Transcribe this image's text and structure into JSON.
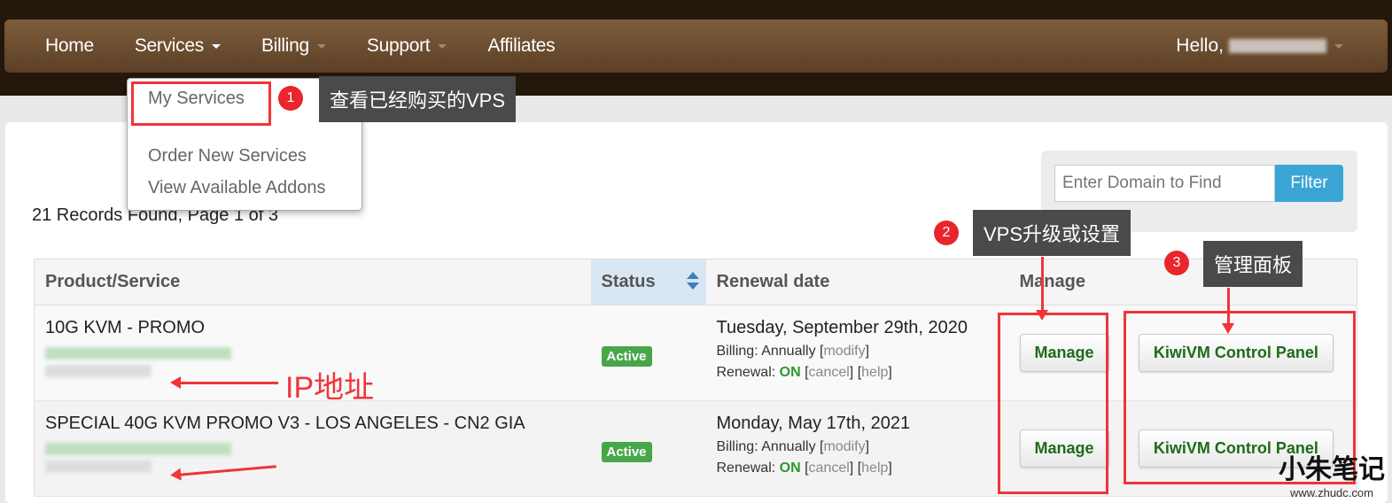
{
  "nav": {
    "items": [
      {
        "label": "Home",
        "dropdown": false
      },
      {
        "label": "Services",
        "dropdown": true
      },
      {
        "label": "Billing",
        "dropdown": true
      },
      {
        "label": "Support",
        "dropdown": true
      },
      {
        "label": "Affiliates",
        "dropdown": false
      }
    ],
    "hello": "Hello,"
  },
  "services_menu": {
    "items": [
      "My Services",
      "Order New Services",
      "View Available Addons"
    ]
  },
  "records": "21 Records Found, Page 1 of 3",
  "filter": {
    "placeholder": "Enter Domain to Find",
    "button": "Filter"
  },
  "table": {
    "headers": [
      "Product/Service",
      "Status",
      "Renewal date",
      "Manage"
    ],
    "rows": [
      {
        "product": "10G KVM - PROMO",
        "status": "Active",
        "renewal": "Tuesday, September 29th, 2020",
        "billing_label": "Billing:",
        "billing": "Annually",
        "modify": "modify",
        "renewal_label": "Renewal:",
        "renewal_state": "ON",
        "cancel": "cancel",
        "help": "help",
        "manage": "Manage",
        "panel": "KiwiVM Control Panel"
      },
      {
        "product": "SPECIAL 40G KVM PROMO V3 - LOS ANGELES - CN2 GIA",
        "status": "Active",
        "renewal": "Monday, May 17th, 2021",
        "billing_label": "Billing:",
        "billing": "Annually",
        "modify": "modify",
        "renewal_label": "Renewal:",
        "renewal_state": "ON",
        "cancel": "cancel",
        "help": "help",
        "manage": "Manage",
        "panel": "KiwiVM Control Panel"
      }
    ]
  },
  "annotations": {
    "c1_num": "1",
    "c1": "查看已经购买的VPS",
    "c2_num": "2",
    "c2": "VPS升级或设置",
    "c3_num": "3",
    "c3": "管理面板",
    "ip": "IP地址"
  },
  "watermark": {
    "cn": "小朱笔记",
    "url": "www.zhudc.com"
  },
  "colors": {
    "nav": "#6b4c30",
    "filter": "#3ba6d6",
    "active": "#48a64a",
    "annotation": "#f0343a"
  }
}
